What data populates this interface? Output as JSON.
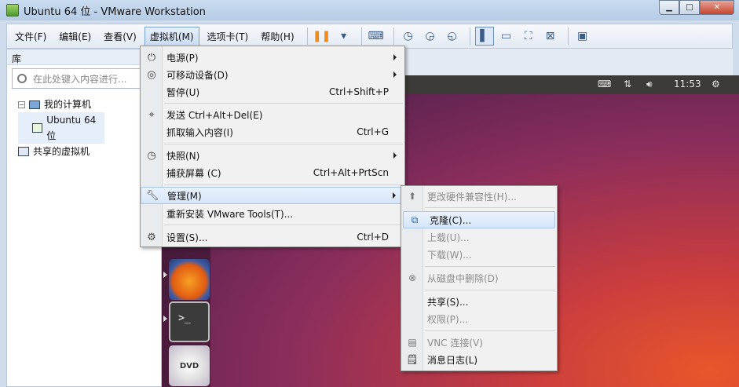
{
  "window": {
    "title": "Ubuntu 64 位 - VMware Workstation"
  },
  "menubar": {
    "items": [
      "文件(F)",
      "编辑(E)",
      "查看(V)",
      "虚拟机(M)",
      "选项卡(T)",
      "帮助(H)"
    ]
  },
  "library": {
    "header": "库",
    "search_placeholder": "在此处键入内容进行...",
    "tree": {
      "my_computer": "我的计算机",
      "vm": "Ubuntu 64 位",
      "shared": "共享的虚拟机"
    }
  },
  "ubuntu": {
    "clock": "11:53",
    "terminal_prompt": ">_",
    "dvd_label": "DVD"
  },
  "vm_menu": {
    "power": "电源(P)",
    "removable": "可移动设备(D)",
    "pause": "暂停(U)",
    "pause_shortcut": "Ctrl+Shift+P",
    "send_cad": "发送 Ctrl+Alt+Del(E)",
    "grab_input": "抓取输入内容(I)",
    "grab_shortcut": "Ctrl+G",
    "snapshot": "快照(N)",
    "capture": "捕获屏幕 (C)",
    "capture_shortcut": "Ctrl+Alt+PrtScn",
    "manage": "管理(M)",
    "reinstall_tools": "重新安装 VMware Tools(T)...",
    "settings": "设置(S)...",
    "settings_shortcut": "Ctrl+D"
  },
  "manage_menu": {
    "hw_compat": "更改硬件兼容性(H)...",
    "clone": "克隆(C)...",
    "upload": "上载(U)...",
    "download": "下载(W)...",
    "delete_disk": "从磁盘中删除(D)",
    "share": "共享(S)...",
    "permissions": "权限(P)...",
    "vnc": "VNC 连接(V)",
    "message_log": "消息日志(L)"
  }
}
